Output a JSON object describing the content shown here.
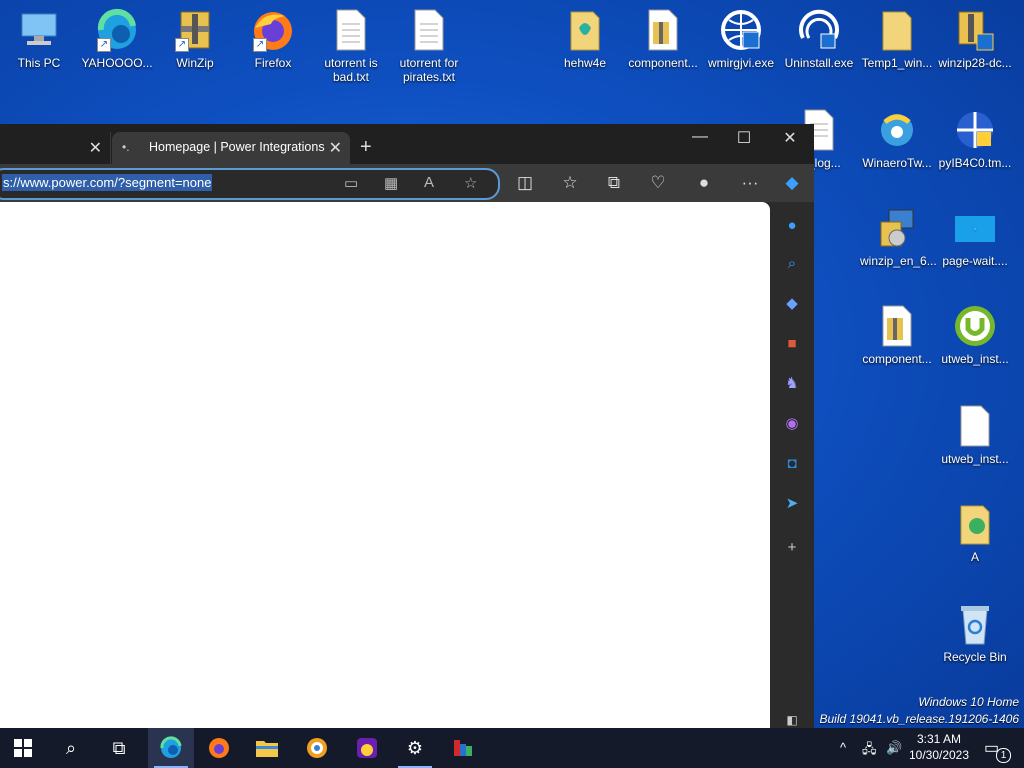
{
  "desktop": {
    "icons": [
      {
        "label": "This PC"
      },
      {
        "label": "YAHOOOO..."
      },
      {
        "label": "WinZip"
      },
      {
        "label": "Firefox"
      },
      {
        "label": "utorrent is bad.txt"
      },
      {
        "label": "utorrent for pirates.txt"
      },
      {
        "label": "hehw4e"
      },
      {
        "label": "component..."
      },
      {
        "label": "wmirgjvi.exe"
      },
      {
        "label": "Uninstall.exe"
      },
      {
        "label": "Temp1_win..."
      },
      {
        "label": "winzip28-dc..."
      },
      {
        "label": "er_log..."
      },
      {
        "label": "WinaeroTw..."
      },
      {
        "label": "pyIB4C0.tm..."
      },
      {
        "label": "winzip_en_6..."
      },
      {
        "label": "page-wait...."
      },
      {
        "label": "component..."
      },
      {
        "label": "utweb_inst..."
      },
      {
        "label": "utweb_inst..."
      },
      {
        "label": "A"
      },
      {
        "label": "Recycle Bin"
      }
    ],
    "watermark": {
      "line1": "Windows 10 Home",
      "line2": "Build 19041.vb_release.191206-1406"
    }
  },
  "browser": {
    "tabs": [
      {
        "label": ""
      },
      {
        "label": "Homepage | Power Integrations"
      }
    ],
    "address": "s://www.power.com/?segment=none"
  },
  "taskbar": {
    "clock_time": "3:31 AM",
    "clock_date": "10/30/2023",
    "notification_count": "1"
  },
  "colors": {
    "accent": "#5b9bd5",
    "desktop": "#0e4fc0",
    "taskbar": "#141a2a"
  }
}
